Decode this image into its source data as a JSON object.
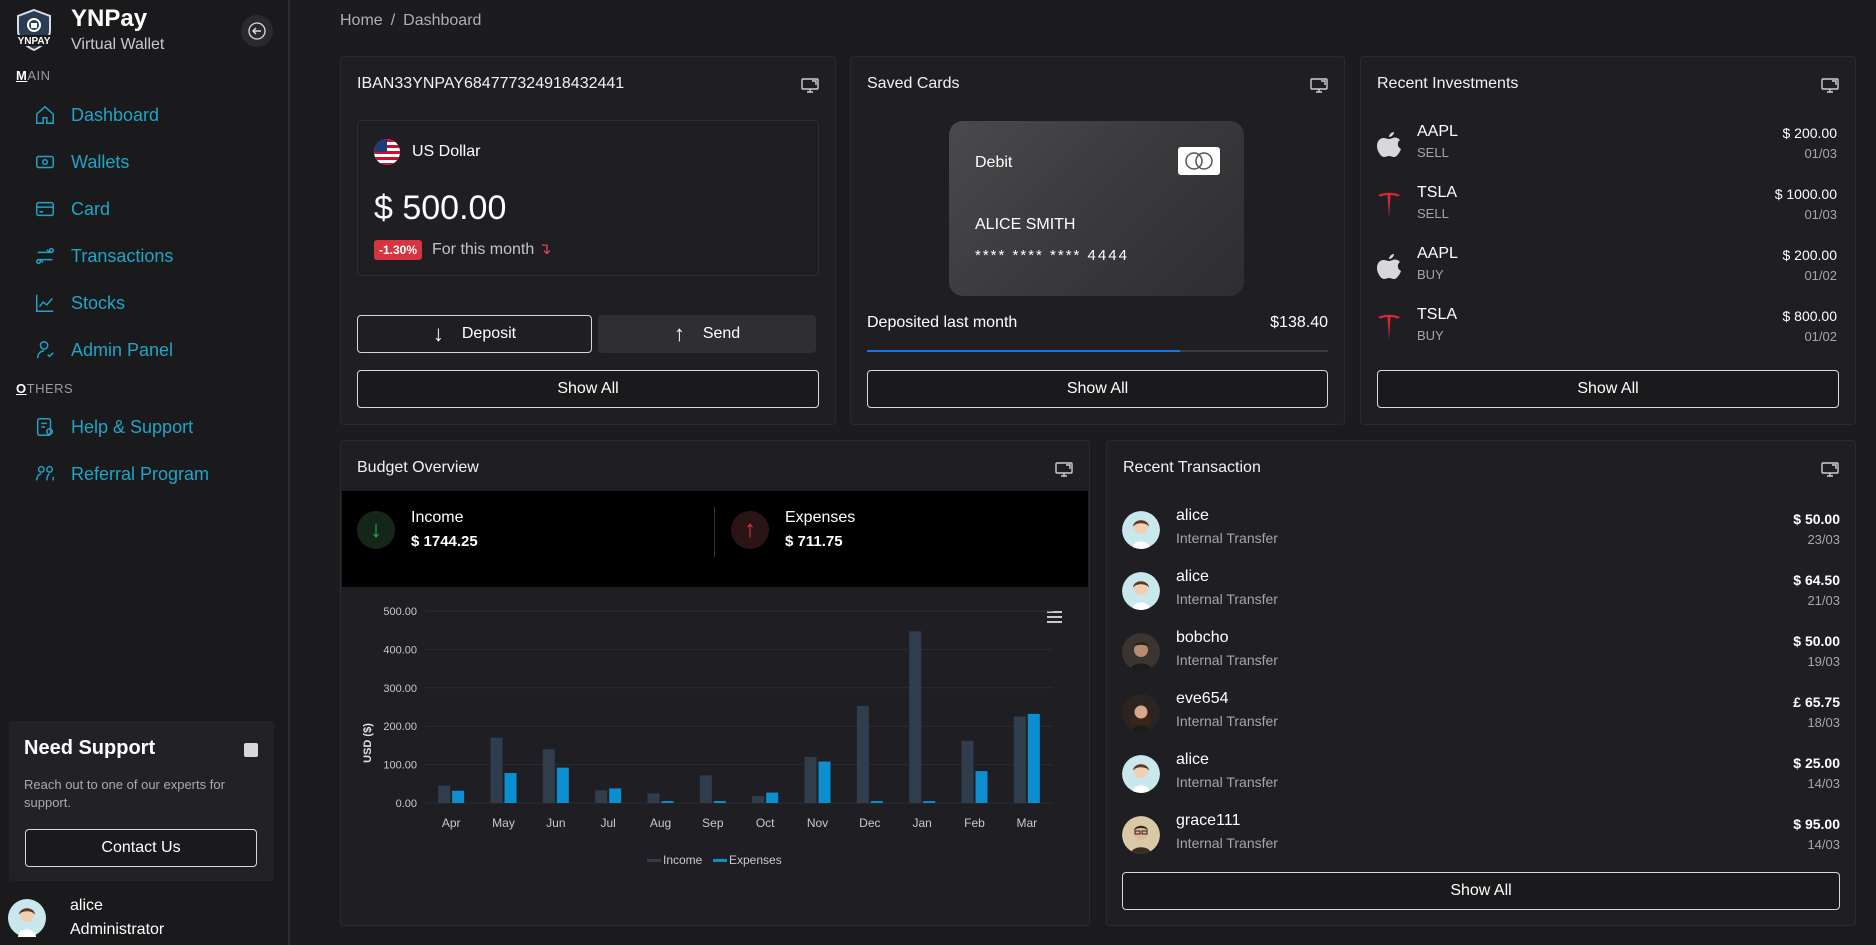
{
  "brand": {
    "name": "YNPay",
    "subtitle": "Virtual Wallet",
    "logo_text": "YNPAY"
  },
  "sidebar": {
    "main_label_first": "M",
    "main_label_rest": "AIN",
    "others_label_first": "O",
    "others_label_rest": "THERS",
    "main_items": [
      {
        "label": "Dashboard",
        "icon": "home-icon"
      },
      {
        "label": "Wallets",
        "icon": "wallet-icon"
      },
      {
        "label": "Card",
        "icon": "card-icon"
      },
      {
        "label": "Transactions",
        "icon": "transactions-icon"
      },
      {
        "label": "Stocks",
        "icon": "stocks-icon"
      },
      {
        "label": "Admin Panel",
        "icon": "admin-icon"
      }
    ],
    "other_items": [
      {
        "label": "Help & Support",
        "icon": "help-icon"
      },
      {
        "label": "Referral Program",
        "icon": "referral-icon"
      }
    ],
    "support": {
      "title": "Need Support",
      "text": "Reach out to one of our experts for support.",
      "button": "Contact Us"
    },
    "user": {
      "name": "alice",
      "role": "Administrator"
    }
  },
  "breadcrumb": {
    "home": "Home",
    "separator": "/",
    "current": "Dashboard"
  },
  "wallet": {
    "iban": "IBAN33YNPAY684777324918432441",
    "currency": "US Dollar",
    "balance": "$ 500.00",
    "change": "-1.30%",
    "change_text": "For this month",
    "change_arrow": "↴",
    "deposit_label": "Deposit",
    "send_label": "Send",
    "show_all": "Show All"
  },
  "saved_cards": {
    "title": "Saved Cards",
    "card_type": "Debit",
    "holder": "ALICE SMITH",
    "number": "**** **** **** 4444",
    "deposited_label": "Deposited last month",
    "deposited_value": "$138.40",
    "deposited_progress": 0.68,
    "show_all": "Show All"
  },
  "investments": {
    "title": "Recent Investments",
    "items": [
      {
        "symbol": "AAPL",
        "type": "SELL",
        "amount": "$ 200.00",
        "date": "01/03",
        "logo": "apple"
      },
      {
        "symbol": "TSLA",
        "type": "SELL",
        "amount": "$ 1000.00",
        "date": "01/03",
        "logo": "tesla"
      },
      {
        "symbol": "AAPL",
        "type": "BUY",
        "amount": "$ 200.00",
        "date": "01/02",
        "logo": "apple"
      },
      {
        "symbol": "TSLA",
        "type": "BUY",
        "amount": "$ 800.00",
        "date": "01/02",
        "logo": "tesla"
      }
    ],
    "show_all": "Show All"
  },
  "budget": {
    "title": "Budget Overview",
    "income_label": "Income",
    "income_value": "$ 1744.25",
    "expenses_label": "Expenses",
    "expenses_value": "$ 711.75"
  },
  "transactions": {
    "title": "Recent Transaction",
    "items": [
      {
        "name": "alice",
        "type": "Internal Transfer",
        "amount": "$ 50.00",
        "date": "23/03",
        "avatar": "alice"
      },
      {
        "name": "alice",
        "type": "Internal Transfer",
        "amount": "$ 64.50",
        "date": "21/03",
        "avatar": "alice"
      },
      {
        "name": "bobcho",
        "type": "Internal Transfer",
        "amount": "$ 50.00",
        "date": "19/03",
        "avatar": "bobcho"
      },
      {
        "name": "eve654",
        "type": "Internal Transfer",
        "amount": "£ 65.75",
        "date": "18/03",
        "avatar": "eve"
      },
      {
        "name": "alice",
        "type": "Internal Transfer",
        "amount": "$ 25.00",
        "date": "14/03",
        "avatar": "alice"
      },
      {
        "name": "grace111",
        "type": "Internal Transfer",
        "amount": "$ 95.00",
        "date": "14/03",
        "avatar": "grace"
      }
    ],
    "show_all": "Show All"
  },
  "colors": {
    "accent": "#1ea5c6",
    "income_bar": "#2f3d4d",
    "expenses_bar": "#0b8fd1",
    "negative": "#d63440",
    "progress": "#1574e6"
  },
  "chart_data": {
    "type": "bar",
    "categories": [
      "Apr",
      "May",
      "Jun",
      "Jul",
      "Aug",
      "Sep",
      "Oct",
      "Nov",
      "Dec",
      "Jan",
      "Feb",
      "Mar"
    ],
    "series": [
      {
        "name": "Income",
        "values": [
          45,
          170,
          140,
          33,
          25,
          72,
          18,
          120,
          253,
          447,
          162,
          225
        ]
      },
      {
        "name": "Expenses",
        "values": [
          32,
          78,
          92,
          38,
          5,
          5,
          27,
          108,
          5,
          5,
          83,
          232
        ]
      }
    ],
    "ylabel": "USD ($)",
    "yticks": [
      "0.00",
      "100.00",
      "200.00",
      "300.00",
      "400.00",
      "500.00"
    ],
    "ylim": [
      0,
      500
    ],
    "legend": "bottom-center",
    "grid": true
  }
}
